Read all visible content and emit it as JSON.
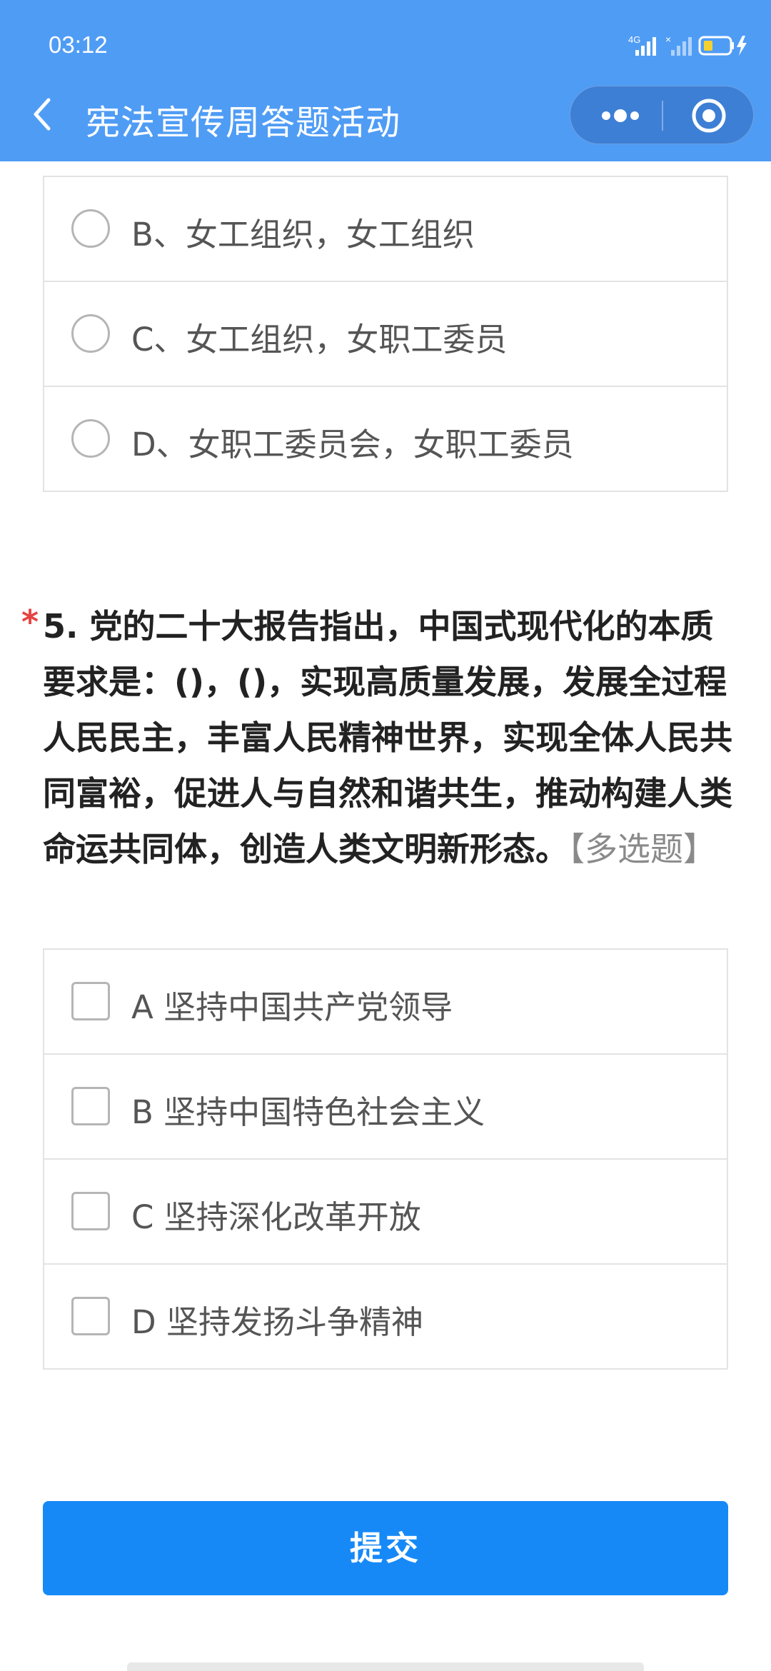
{
  "status_bar": {
    "time": "03:12",
    "signal_label": "4G"
  },
  "nav": {
    "title": "宪法宣传周答题活动"
  },
  "q4_options": [
    {
      "label": "B、女工组织，女工组织"
    },
    {
      "label": "C、女工组织，女职工委员"
    },
    {
      "label": "D、女职工委员会，女职工委员"
    }
  ],
  "question5": {
    "required_mark": "*",
    "text": "5. 党的二十大报告指出，中国式现代化的本质要求是：()，()，实现高质量发展，发展全过程人民民主，丰富人民精神世界，实现全体人民共同富裕，促进人与自然和谐共生，推动构建人类命运共同体，创造人类文明新形态。",
    "type_tag": "【多选题】",
    "options": [
      {
        "label": "A 坚持中国共产党领导"
      },
      {
        "label": "B 坚持中国特色社会主义"
      },
      {
        "label": "C 坚持深化改革开放"
      },
      {
        "label": "D 坚持发扬斗争精神"
      }
    ]
  },
  "submit": {
    "label": "提交"
  },
  "colors": {
    "header_bg": "#4f9cf5",
    "submit_bg": "#1689f7",
    "required": "#e64340"
  }
}
